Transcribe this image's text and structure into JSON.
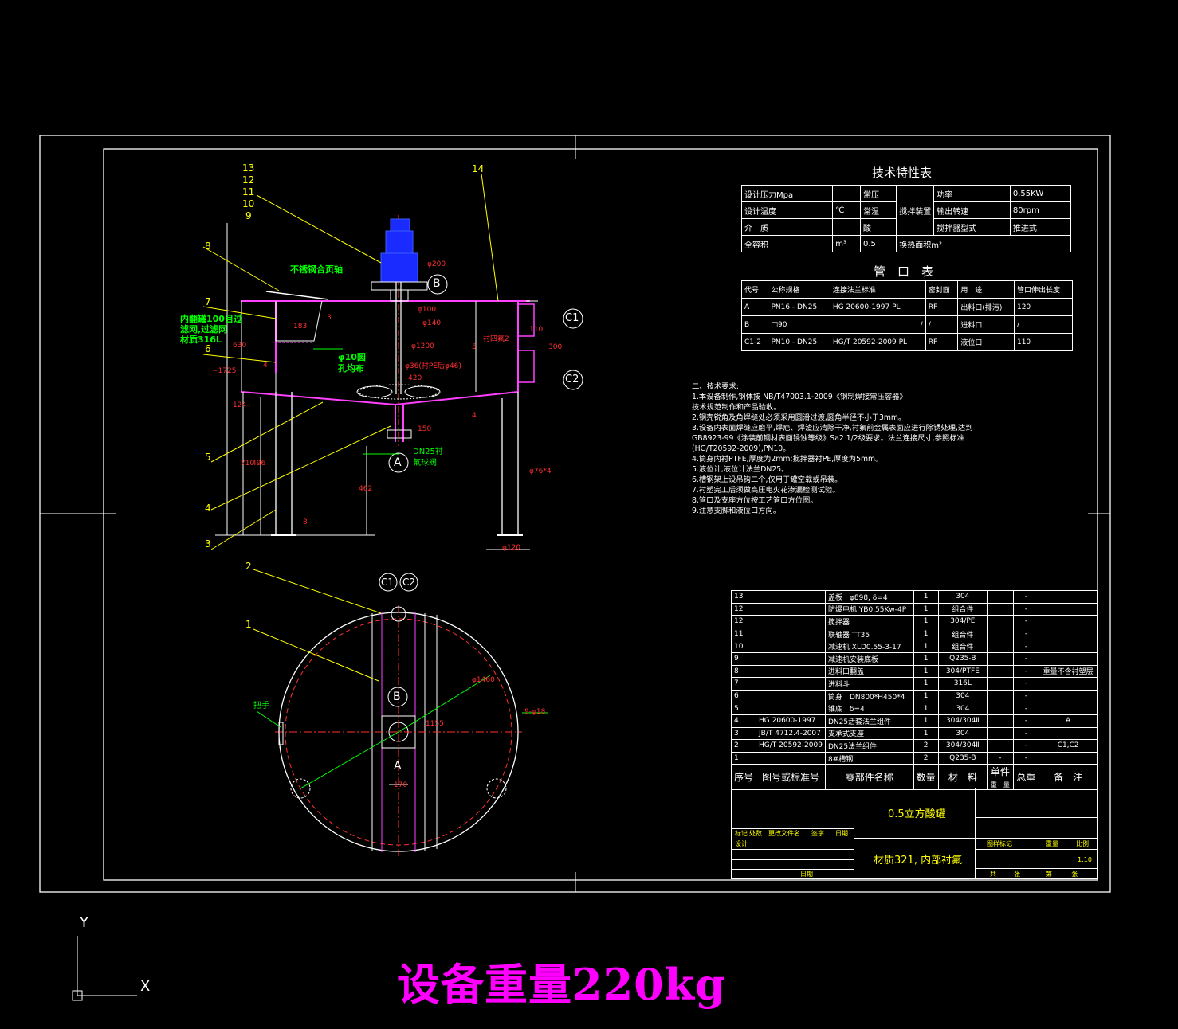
{
  "spec_table": {
    "title": "技术特性表",
    "rows": [
      [
        "设计压力Mpa",
        "",
        "常压",
        "搅拌装置",
        "功率",
        "0.55KW"
      ],
      [
        "设计温度",
        "℃",
        "常温",
        "",
        "输出转速",
        "80rpm"
      ],
      [
        "介　质",
        "",
        "酸",
        "",
        "搅拌器型式",
        "推进式"
      ],
      [
        "全容积",
        "m³",
        "0.5",
        "",
        "换热面积m²",
        ""
      ]
    ]
  },
  "ports_table": {
    "title": "管　口　表",
    "headers": [
      "代号",
      "公称规格",
      "连接法兰标准",
      "密封面",
      "用　途",
      "管口伸出长度"
    ],
    "rows": [
      [
        "A",
        "PN16 - DN25",
        "HG 20600-1997 PL",
        "RF",
        "出料口(排污)",
        "120"
      ],
      [
        "B",
        "□90",
        "/",
        "/",
        "进料口",
        "/"
      ],
      [
        "C1-2",
        "PN10 - DN25",
        "HG/T 20592-2009 PL",
        "RF",
        "液位口",
        "110"
      ]
    ]
  },
  "requirements": [
    "二、技术要求:",
    "1.本设备制作,钢体按 NB/T47003.1-2009《钢制焊接常压容器》",
    "  技术规范制作和产品验收。",
    "2.钢壳锐角及角焊缝处必须采用圆滑过渡,圆角半径不小于3mm。",
    "3.设备内表面焊缝应磨平,焊疤、焊渣应清除干净,衬氟前金属表面应进行除锈处理,达到",
    "  GB8923-99《涂装前钢材表面锈蚀等级》Sa2 1/2级要求。法兰连接尺寸,参照标准",
    "  (HG/T20592-2009),PN10。",
    "4.筒身内衬PTFE,厚度为2mm;搅拌器衬PE,厚度为5mm。",
    "5.液位计,液位计法兰DN25。",
    "6.槽钢架上设吊钩二个,仅用于罐空载或吊装。",
    "7.衬塑完工后须做高压电火花渗漏检测试验。",
    "8.管口及支座方位按工艺管口方位图。",
    "9.注意支脚和液位口方向。"
  ],
  "parts_table": {
    "rows": [
      [
        "13",
        "",
        "盖板　φ898, δ=4",
        "1",
        "304",
        "",
        "-",
        ""
      ],
      [
        "12",
        "",
        "防爆电机 YB0.55Kw-4P",
        "1",
        "组合件",
        "",
        "-",
        ""
      ],
      [
        "12",
        "",
        "搅拌器",
        "1",
        "304/PE",
        "",
        "-",
        ""
      ],
      [
        "11",
        "",
        "联轴器 TT35",
        "1",
        "组合件",
        "",
        "-",
        ""
      ],
      [
        "10",
        "",
        "减速机 XLD0.55-3-17",
        "1",
        "组合件",
        "",
        "-",
        ""
      ],
      [
        "9",
        "",
        "减速机安装底板",
        "1",
        "Q235-B",
        "",
        "-",
        ""
      ],
      [
        "8",
        "",
        "进料口翻盖",
        "1",
        "304/PTFE",
        "",
        "-",
        "重量不含衬塑层"
      ],
      [
        "7",
        "",
        "进料斗",
        "1",
        "316L",
        "",
        "-",
        ""
      ],
      [
        "6",
        "",
        "筒身　DN800*H450*4",
        "1",
        "304",
        "",
        "-",
        ""
      ],
      [
        "5",
        "",
        "锥底　δ=4",
        "1",
        "304",
        "",
        "-",
        ""
      ],
      [
        "4",
        "HG 20600-1997",
        "DN25活套法兰组件",
        "1",
        "304/304Ⅱ",
        "",
        "-",
        "A"
      ],
      [
        "3",
        "JB/T 4712.4-2007",
        "支承式支座",
        "1",
        "304",
        "",
        "-",
        ""
      ],
      [
        "2",
        "HG/T 20592-2009",
        "DN25法兰组件",
        "2",
        "304/304Ⅱ",
        "",
        "-",
        "C1,C2"
      ],
      [
        "1",
        "",
        "8#槽钢",
        "2",
        "Q235-B",
        "-",
        "-",
        ""
      ]
    ],
    "header": [
      "序号",
      "图号或标准号",
      "零部件名称",
      "数量",
      "材　料",
      "单件",
      "总重",
      "备　注"
    ],
    "header_sub": [
      "",
      "",
      "",
      "",
      "",
      "重　量",
      "",
      ""
    ]
  },
  "title_block": {
    "name": "0.5立方酸罐",
    "material": "材质321, 内部衬氟",
    "scale": "1:10",
    "labels": [
      "标记",
      "处数",
      "更改文件名",
      "签字",
      "日期",
      "设计",
      "日期",
      "图样标记",
      "重量",
      "比例",
      "共",
      "张",
      "第",
      "张"
    ]
  },
  "drawing_labels": {
    "leaders_top": [
      "13",
      "12",
      "11",
      "10",
      "9"
    ],
    "leader_14": "14",
    "leaders_left": [
      "8",
      "7",
      "6",
      "5",
      "4",
      "3"
    ],
    "leaders_plan": [
      "2",
      "1"
    ],
    "cover_note": "不锈钢合页轴",
    "filter_note": [
      "内翻罐100目过",
      "滤网,过滤网",
      "材质316L"
    ],
    "hole_note": [
      "φ10圆",
      "孔均布"
    ],
    "lining_note": "衬四氟2",
    "agitator_note": "φ36(衬PE后φ46)",
    "outlet_note": [
      "DN25衬",
      "氟球阀"
    ],
    "nozzle_labels": [
      "B",
      "C1",
      "C2",
      "A"
    ],
    "dims": [
      "φ200",
      "φ100",
      "φ140",
      "φ1200",
      "420",
      "183",
      "3",
      "5",
      "4",
      "4",
      "110",
      "300",
      "630",
      "~1725",
      "124",
      "710",
      "496",
      "462",
      "150",
      "8",
      "φ76*4",
      "φ120",
      "φ1460",
      "9-φ18",
      "1155",
      "170"
    ],
    "handle_note": "把手",
    "axis_y": "Y",
    "axis_x": "X"
  },
  "weight_note": "设备重量220kg"
}
